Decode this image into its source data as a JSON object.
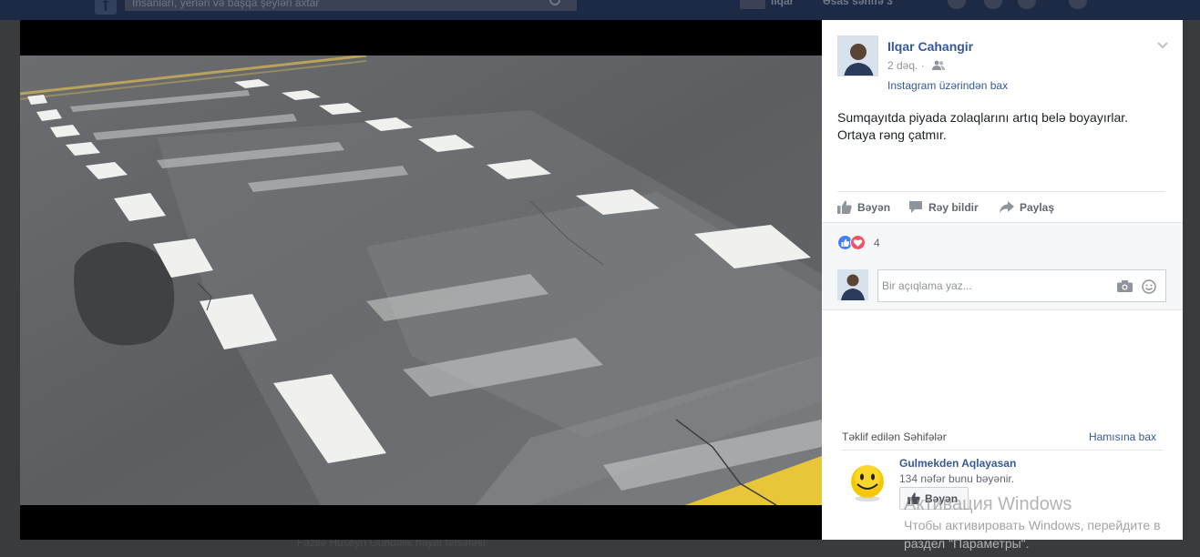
{
  "top_bar": {
    "search_placeholder": "İnsanları, yerləri və başqa şeyləri axtar",
    "user_name": "İlqar",
    "home_label": "Əsas səhifə",
    "home_count": "3"
  },
  "background_feed": {
    "partial_text": "Fazilə Hüseyn  Gündəlik həyat fəlsəfəsi"
  },
  "post": {
    "author": "Ilqar Cahangir",
    "time": "2 dəq. ·",
    "via": "Instagram üzərindən bax",
    "text_lines": [
      "Sumqayıtda piyada zolaqlarını artıq belə boyayırlar.",
      "Ortaya rəng çatmır."
    ],
    "icons": {
      "audience": "friends-icon",
      "menu": "chevron-down-icon"
    }
  },
  "actions": {
    "like": "Bəyən",
    "comment": "Rəy bildir",
    "share": "Paylaş"
  },
  "reactions": {
    "types": [
      "like",
      "love"
    ],
    "count": "4"
  },
  "comment": {
    "placeholder": "Bir açıqlama yaz..."
  },
  "suggested_pages": {
    "title": "Təklif edilən Səhifələr",
    "see_all": "Hamısına bax",
    "items": [
      {
        "name": "Gulmekden Aqlayasan",
        "likes": "134 nəfər bunu bəyənir.",
        "button": "Bəyən"
      }
    ]
  },
  "windows_watermark": {
    "title": "Активация Windows",
    "line1": "Чтобы активировать Windows, перейдите в",
    "line2": "раздел \"Параметры\"."
  },
  "colors": {
    "link": "#365899",
    "like_blue": "#4080ff",
    "love_red": "#f25268",
    "road_marking": "#f0f0ee",
    "yellow_line": "#e8c63a"
  }
}
